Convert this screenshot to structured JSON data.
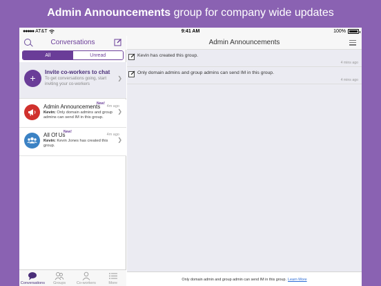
{
  "promo": {
    "title_strong": "Admin Announcements",
    "title_rest": " group for company wide updates"
  },
  "status_bar": {
    "carrier": "AT&T",
    "signal": "●●●●●",
    "time": "9:41 AM",
    "battery": "100%"
  },
  "left_nav": {
    "title": "Conversations"
  },
  "segments": {
    "all": "All",
    "unread": "Unread"
  },
  "invite": {
    "title": "Invite co-workers to chat",
    "subtitle": "To get conversations going, start inviting your co-workers"
  },
  "conversations": [
    {
      "name": "Admin Announcements",
      "badge": "New!",
      "time": "4m ago",
      "sender": "Kevin:",
      "preview": " Only domain admins and group admins can send IM in this group."
    },
    {
      "name": "All Of Us",
      "badge": "New!",
      "time": "4m ago",
      "sender": "Kevin:",
      "preview": " Kevin Jones has created this group."
    }
  ],
  "tabs": [
    {
      "label": "Conversations",
      "icon": "chat-bubble-icon",
      "active": true
    },
    {
      "label": "Groups",
      "icon": "groups-icon",
      "active": false
    },
    {
      "label": "Co-workers",
      "icon": "person-icon",
      "active": false
    },
    {
      "label": "More",
      "icon": "more-list-icon",
      "active": false
    }
  ],
  "right_nav": {
    "title": "Admin Announcements"
  },
  "messages": [
    {
      "text": "Kevin has created this group.",
      "time": "4 mins ago"
    },
    {
      "text": "Only domain admins and group admins can send IM in this group.",
      "time": "4 mins ago"
    }
  ],
  "footer": {
    "notice": "Only domain admin and group admin can send IM in this group.",
    "link": "Learn More"
  },
  "colors": {
    "background": "#8a62b2",
    "accent": "#6a3d98",
    "announcement_avatar": "#d0312d",
    "group_avatar": "#3b82c4"
  }
}
